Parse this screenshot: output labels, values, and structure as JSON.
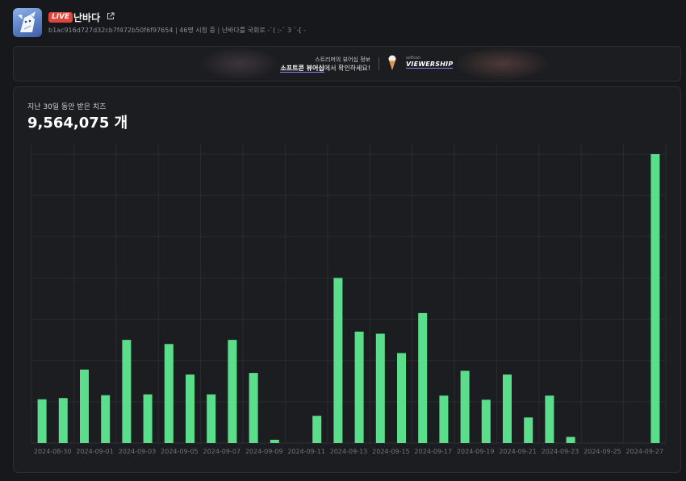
{
  "channel": {
    "live_label": "LIVE",
    "name": "난바다",
    "info_line": "b1ac916d727d32cb7f472b50f6f97654 | 46명 시청 중 | 난바다를 국회로 -`( ;-` 3 `-[ -"
  },
  "banner": {
    "line1": "스트리머의 뷰어십 정보",
    "line2_highlight": "소프트콘 뷰어십",
    "line2_rest": "에서 확인하세요!",
    "logo_small": "softcon",
    "logo": "VIEWERSHIP"
  },
  "chart": {
    "subtitle": "지난 30일 동안 받은 치즈",
    "total": "9,564,075 개"
  },
  "colors": {
    "bar": "#5bde8b",
    "background": "#17181b",
    "card": "#1c1d20",
    "live": "#e0443a",
    "accent": "#7d86ff"
  },
  "chart_data": {
    "type": "bar",
    "ylim": [
      0,
      700000
    ],
    "grid": true,
    "x": [
      "2024-08-30",
      "2024-08-31",
      "2024-09-01",
      "2024-09-02",
      "2024-09-03",
      "2024-09-04",
      "2024-09-05",
      "2024-09-06",
      "2024-09-07",
      "2024-09-08",
      "2024-09-09",
      "2024-09-10",
      "2024-09-11",
      "2024-09-12",
      "2024-09-13",
      "2024-09-14",
      "2024-09-15",
      "2024-09-16",
      "2024-09-17",
      "2024-09-18",
      "2024-09-19",
      "2024-09-20",
      "2024-09-21",
      "2024-09-22",
      "2024-09-23",
      "2024-09-24",
      "2024-09-25",
      "2024-09-26",
      "2024-09-27",
      "2024-09-28"
    ],
    "values": [
      106000,
      109000,
      178000,
      116000,
      250000,
      118000,
      240000,
      166000,
      118000,
      250000,
      170000,
      8000,
      0,
      66000,
      400000,
      270000,
      265000,
      218000,
      315000,
      115000,
      175000,
      105000,
      166000,
      62000,
      115000,
      15000,
      0,
      0,
      0,
      700000
    ],
    "x_tick_labels": [
      "2024-08-30",
      "2024-09-01",
      "2024-09-03",
      "2024-09-05",
      "2024-09-07",
      "2024-09-09",
      "2024-09-11",
      "2024-09-13",
      "2024-09-15",
      "2024-09-17",
      "2024-09-19",
      "2024-09-21",
      "2024-09-23",
      "2024-09-25",
      "2024-09-27"
    ]
  }
}
